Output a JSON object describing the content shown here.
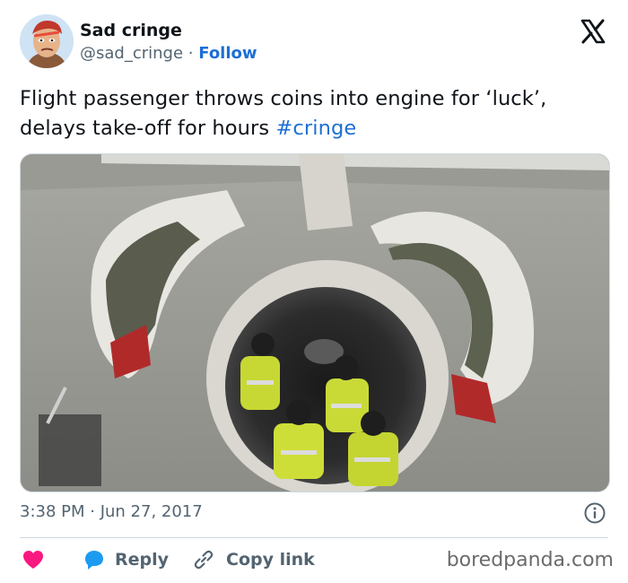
{
  "author": {
    "display_name": "Sad cringe",
    "handle": "@sad_cringe",
    "separator": "·",
    "follow_label": "Follow",
    "avatar_icon": "cartoon-avatar-icon"
  },
  "platform_icon": "x-logo-icon",
  "tweet": {
    "text": "Flight passenger throws coins into engine for ‘luck’, delays take-off for hours",
    "hashtag": "#cringe"
  },
  "photo_icon": "airplane-engine-photo",
  "meta": {
    "timestamp": "3:38 PM · Jun 27, 2017",
    "info_icon": "info-icon"
  },
  "actions": {
    "like_icon": "heart-icon",
    "reply_label": "Reply",
    "reply_icon": "speech-bubble-icon",
    "copy_label": "Copy link",
    "copy_icon": "link-icon"
  },
  "watermark": "boredpanda.com",
  "colors": {
    "link_blue": "#1d6fd4",
    "like_pink": "#f91880",
    "reply_blue": "#1d9bf0",
    "muted_text": "#536471"
  }
}
